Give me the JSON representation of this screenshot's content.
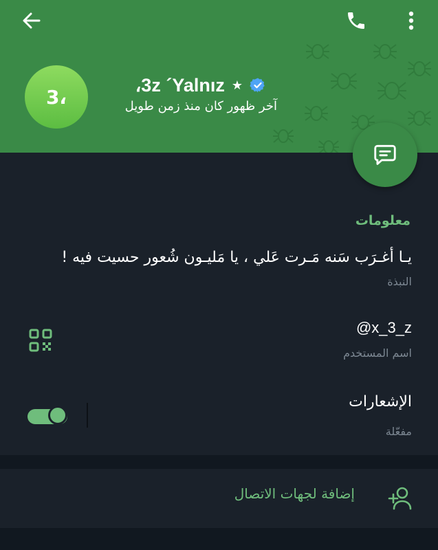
{
  "header": {
    "avatar_text": "3،",
    "name": "،3z ´Yalnız",
    "star": "★",
    "last_seen": "آخر ظهور كان منذ زمن طويل"
  },
  "info": {
    "section_title": "معلومات",
    "bio": "يـا أغـرَب سَنه مَـرت عَلي ، يا مَليـون شُعور حسيت فيه !",
    "bio_label": "النبذة",
    "username": "@x_3_z",
    "username_label": "اسم المستخدم",
    "notifications_title": "الإشعارات",
    "notifications_state": "مفعّلة",
    "notifications_enabled": true
  },
  "actions": {
    "add_contact": "إضافة لجهات الاتصال"
  },
  "icons": [
    "back-arrow-icon",
    "phone-icon",
    "more-vert-icon",
    "verified-badge-icon",
    "message-icon",
    "qr-code-icon",
    "add-contact-icon"
  ],
  "colors": {
    "header": "#3a8a47",
    "accent": "#6fbd7c",
    "background": "#1a212a",
    "verified": "#4ea4f6"
  }
}
